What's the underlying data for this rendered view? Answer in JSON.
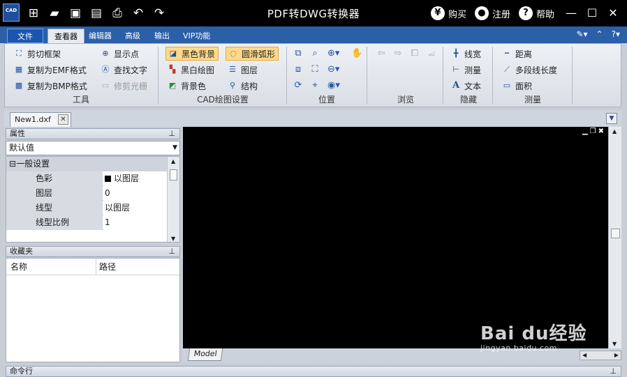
{
  "app": {
    "title": "PDF转DWG转换器",
    "logo_text": "CAD",
    "buy_label": "购买",
    "register_label": "注册",
    "help_label": "帮助",
    "buy_icon_glyph": "¥",
    "help_icon_glyph": "?"
  },
  "ribbon": {
    "file_tab": "文件",
    "tabs": [
      "查看器",
      "编辑器",
      "高级",
      "输出",
      "VIP功能"
    ],
    "active_tab": "查看器",
    "groups": {
      "tools": {
        "label": "工具",
        "items": [
          "剪切框架",
          "复制为EMF格式",
          "复制为BMP格式",
          "显示点",
          "查找文字",
          "修剪光栅"
        ]
      },
      "cad_settings": {
        "label": "CAD绘图设置",
        "items": [
          "黑色背景",
          "黑白绘图",
          "背景色",
          "圆滑弧形",
          "图层",
          "结构"
        ]
      },
      "position": {
        "label": "位置"
      },
      "browse": {
        "label": "浏览"
      },
      "hide": {
        "label": "隐藏",
        "items": [
          "线宽",
          "测量",
          "文本"
        ]
      },
      "measure": {
        "label": "测量",
        "items": [
          "距离",
          "多段线长度",
          "面积"
        ]
      }
    }
  },
  "document": {
    "tab_name": "New1.dxf",
    "layout_tab": "Model"
  },
  "properties": {
    "title": "属性",
    "selected": "默认值",
    "category": "一般设置",
    "rows": [
      {
        "key": "色彩",
        "value": "以图层"
      },
      {
        "key": "图层",
        "value": "0"
      },
      {
        "key": "线型",
        "value": "以图层"
      },
      {
        "key": "线型比例",
        "value": "1"
      }
    ]
  },
  "favorites": {
    "title": "收藏夹",
    "columns": [
      "名称",
      "路径"
    ]
  },
  "command_line": {
    "title": "命令行"
  },
  "watermark": {
    "brand": "Bai du经验",
    "url": "jingyan.baidu.com"
  }
}
